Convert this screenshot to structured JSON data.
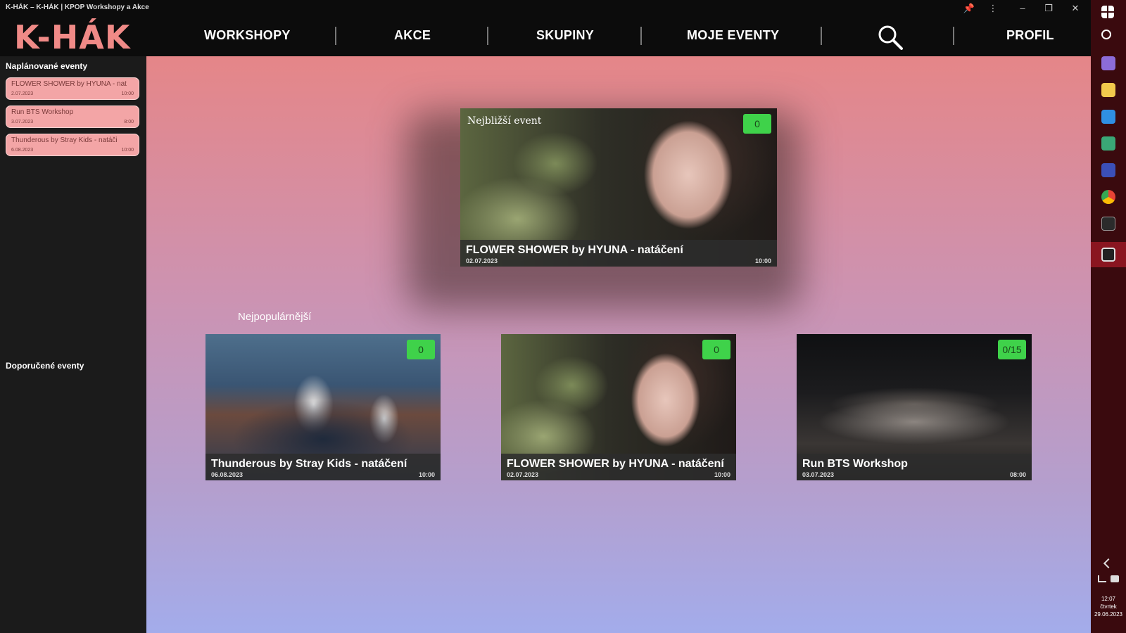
{
  "window": {
    "title": "K-HÁK – K-HÁK | KPOP Workshopy a Akce"
  },
  "header": {
    "logo": "K-HÁK",
    "nav": [
      "WORKSHOPY",
      "AKCE",
      "SKUPINY",
      "MOJE EVENTY",
      "PROFIL"
    ]
  },
  "sidebar": {
    "planned_heading": "Naplánované eventy",
    "planned": [
      {
        "title": "FLOWER SHOWER by HYUNA - nat",
        "date": "2.07.2023",
        "time": "10:00"
      },
      {
        "title": "Run BTS Workshop",
        "date": "3.07.2023",
        "time": "8:00"
      },
      {
        "title": "Thunderous by Stray Kids - natáči",
        "date": "6.08.2023",
        "time": "10:00"
      }
    ],
    "recommended_heading": "Doporučené eventy"
  },
  "featured": {
    "label": "Nejbližší event",
    "title": "FLOWER SHOWER by HYUNA - natáčení",
    "date": "02.07.2023",
    "time": "10:00",
    "count": "0"
  },
  "popular": {
    "heading": "Nejpopulárnější",
    "items": [
      {
        "title": "Thunderous by Stray Kids - natáčení",
        "date": "06.08.2023",
        "time": "10:00",
        "count": "0"
      },
      {
        "title": "FLOWER SHOWER by HYUNA - natáčení",
        "date": "02.07.2023",
        "time": "10:00",
        "count": "0"
      },
      {
        "title": "Run BTS Workshop",
        "date": "03.07.2023",
        "time": "08:00",
        "count": "0/15"
      }
    ]
  },
  "taskbar": {
    "time": "12:07",
    "day": "čtvrtek",
    "date": "29.06.2023"
  },
  "colors": {
    "accent": "#f08a87",
    "badge": "#3fd24a",
    "sidebar_card": "#f3a5a6"
  }
}
